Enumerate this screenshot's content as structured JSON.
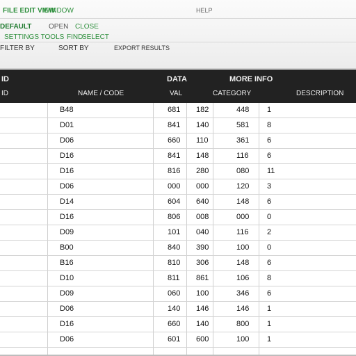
{
  "toolbar": {
    "row1": {
      "a": "FILE  EDIT  VIEW",
      "b": "WINDOW",
      "c": "HELP"
    },
    "row2": {
      "a": "DEFAULT",
      "b": "OPEN",
      "c": "CLOSE"
    },
    "row3": {
      "a": "SETTINGS  TOOLS",
      "b": "FIND",
      "c": "SELECT"
    },
    "row4": {
      "a": "FILTER BY",
      "b": "SORT BY",
      "c": "EXPORT RESULTS"
    }
  },
  "table": {
    "header_top": [
      "ID",
      "DATA",
      "MORE INFO"
    ],
    "header_cols": [
      "ID",
      "NAME / CODE",
      "VAL",
      "CATEGORY",
      "DESCRIPTION"
    ],
    "rows": [
      {
        "name": "B48",
        "a": "681",
        "b": "182",
        "c": "448",
        "d": "1"
      },
      {
        "name": "D01",
        "a": "841",
        "b": "140",
        "c": "581",
        "d": "8"
      },
      {
        "name": "D06",
        "a": "660",
        "b": "110",
        "c": "361",
        "d": "6"
      },
      {
        "name": "D16",
        "a": "841",
        "b": "148",
        "c": "116",
        "d": "6"
      },
      {
        "name": "D16",
        "a": "816",
        "b": "280",
        "c": "080",
        "d": "11"
      },
      {
        "name": "D06",
        "a": "000",
        "b": "000",
        "c": "120",
        "d": "3"
      },
      {
        "name": "D14",
        "a": "604",
        "b": "640",
        "c": "148",
        "d": "6"
      },
      {
        "name": "D16",
        "a": "806",
        "b": "008",
        "c": "000",
        "d": "0"
      },
      {
        "name": "D09",
        "a": "101",
        "b": "040",
        "c": "116",
        "d": "2"
      },
      {
        "name": "B00",
        "a": "840",
        "b": "390",
        "c": "100",
        "d": "0"
      },
      {
        "name": "B16",
        "a": "810",
        "b": "306",
        "c": "148",
        "d": "6"
      },
      {
        "name": "D10",
        "a": "811",
        "b": "861",
        "c": "106",
        "d": "8"
      },
      {
        "name": "D09",
        "a": "060",
        "b": "100",
        "c": "346",
        "d": "6"
      },
      {
        "name": "D06",
        "a": "140",
        "b": "146",
        "c": "146",
        "d": "1"
      },
      {
        "name": "D16",
        "a": "660",
        "b": "140",
        "c": "800",
        "d": "1"
      },
      {
        "name": "D06",
        "a": "601",
        "b": "600",
        "c": "100",
        "d": "1"
      }
    ]
  }
}
